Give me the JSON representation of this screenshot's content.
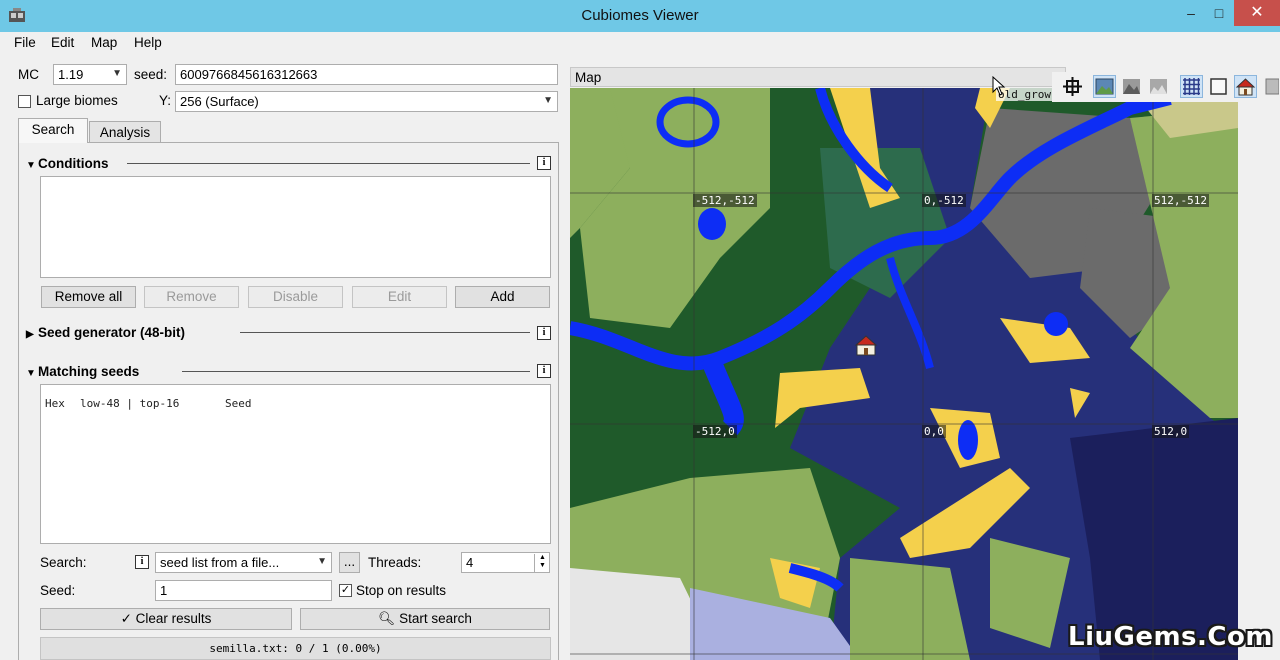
{
  "window": {
    "title": "Cubiomes Viewer",
    "minimize": "–",
    "maximize": "□",
    "close": "✕"
  },
  "menu": [
    "File",
    "Edit",
    "Map",
    "Help"
  ],
  "config": {
    "mc_label": "MC",
    "mc_version": "1.19",
    "seed_label": "seed:",
    "seed_value": "6009766845616312663",
    "large_biomes_label": "Large biomes",
    "large_biomes_checked": false,
    "y_label": "Y:",
    "y_value": "256 (Surface)"
  },
  "tabs": [
    {
      "label": "Search",
      "active": true
    },
    {
      "label": "Analysis",
      "active": false
    }
  ],
  "conditions": {
    "title": "Conditions",
    "buttons": [
      {
        "label": "Remove all",
        "enabled": true
      },
      {
        "label": "Remove",
        "enabled": false
      },
      {
        "label": "Disable",
        "enabled": false
      },
      {
        "label": "Edit",
        "enabled": false
      },
      {
        "label": "Add",
        "enabled": true
      }
    ]
  },
  "seed_generator": {
    "title": "Seed generator (48-bit)"
  },
  "matching": {
    "title": "Matching seeds",
    "columns": [
      "Hex",
      "low-48 | top-16",
      "Seed"
    ]
  },
  "search": {
    "search_label": "Search:",
    "search_mode": "seed list from a file...",
    "browse_label": "...",
    "threads_label": "Threads:",
    "threads_value": "4",
    "seed_label": "Seed:",
    "seed_value": "1",
    "stop_label": "Stop on results",
    "stop_checked": true,
    "clear_label": "Clear results",
    "start_label": "Start search",
    "status": "semilla.txt: 0 / 1 (0.00%)"
  },
  "map": {
    "title": "Map",
    "hover_label": "old_grow",
    "coords": [
      "-512,-512",
      "0,-512",
      "512,-512",
      "-512,0",
      "0,0",
      "512,0"
    ],
    "info_icon": "i",
    "colors": {
      "forest": "#1f5a2a",
      "plains": "#8daf5d",
      "ocean": "#26307a",
      "deep_ocean": "#1b1f5c",
      "river": "#0d2df5",
      "beach": "#f4d04c",
      "mountain": "#6b6b6b",
      "taiga": "#2d6b4d",
      "snow": "#e6e6e6"
    }
  },
  "toolbar": [
    {
      "icon": "crosshair-icon",
      "active": false
    },
    {
      "icon": "image-icon",
      "active": true
    },
    {
      "icon": "mountain-icon",
      "active": false
    },
    {
      "icon": "terrain-icon",
      "active": false
    },
    {
      "icon": "grid-icon",
      "active": true
    },
    {
      "icon": "square-icon",
      "active": false
    },
    {
      "icon": "house-icon",
      "active": true
    }
  ],
  "watermark": "LiuGems.Com"
}
